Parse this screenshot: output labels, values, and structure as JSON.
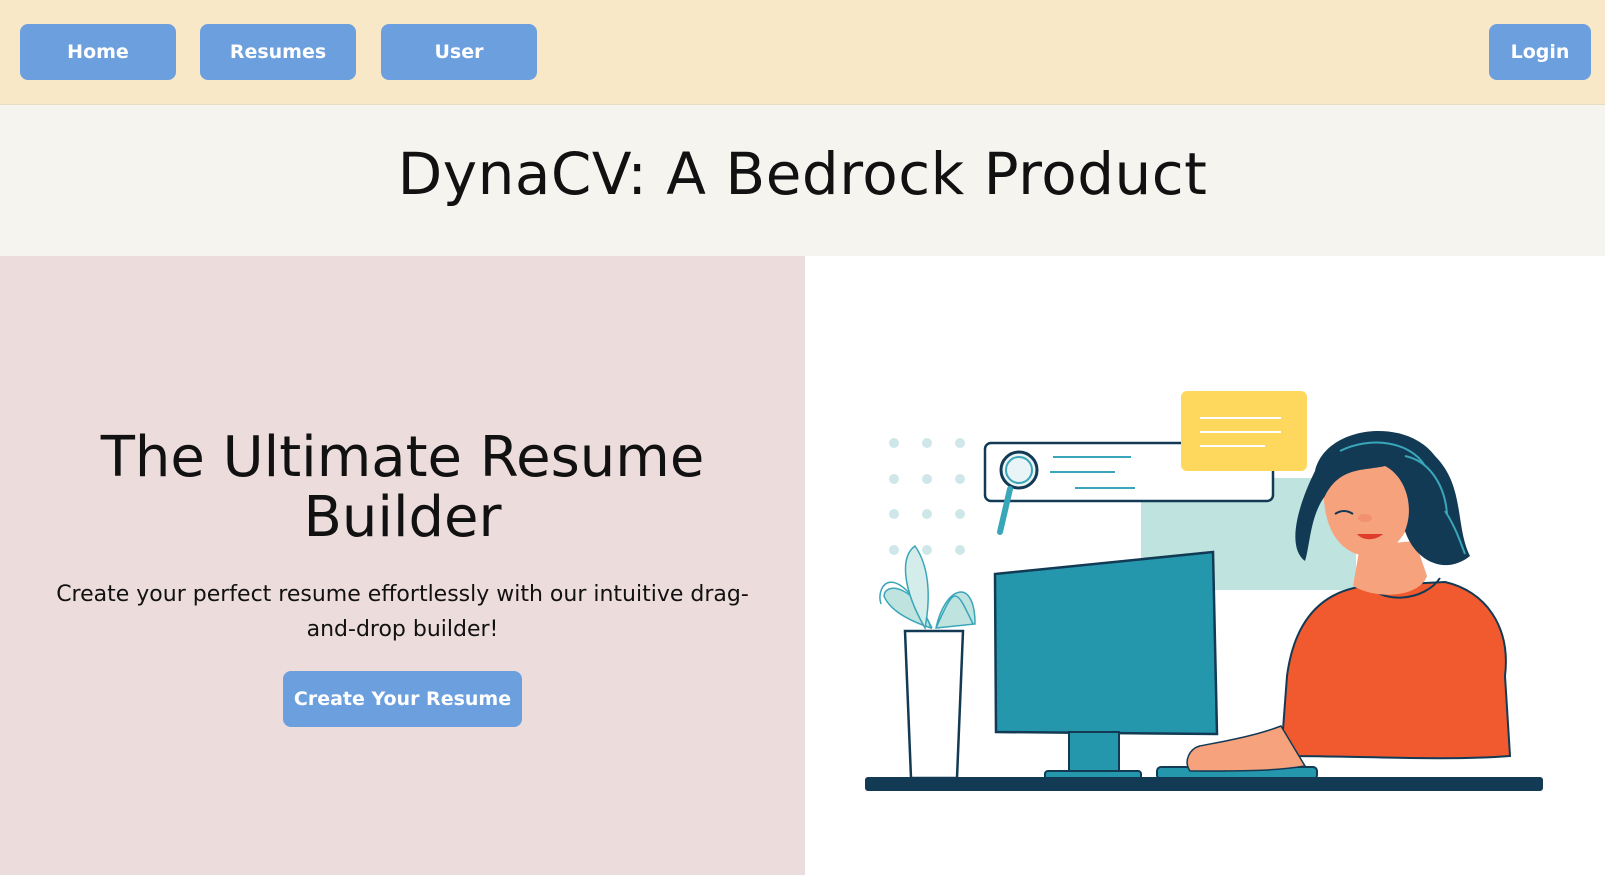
{
  "nav": {
    "home_label": "Home",
    "resumes_label": "Resumes",
    "user_label": "User",
    "login_label": "Login"
  },
  "header": {
    "title": "DynaCV: A Bedrock Product"
  },
  "hero": {
    "heading": "The Ultimate Resume Builder",
    "subtitle": "Create your perfect resume effortlessly with our intuitive drag-and-drop builder!",
    "cta_label": "Create Your Resume",
    "illustration": "woman-working-at-computer-illustration"
  },
  "colors": {
    "nav_background": "#f9e8c8",
    "title_band_background": "#f5f4ef",
    "hero_left_background": "#ecdcdc",
    "button": "#6c9fde",
    "monitor": "#2597ad",
    "shirt": "#f15a2f",
    "note": "#fdd85c",
    "hair": "#123a55"
  }
}
